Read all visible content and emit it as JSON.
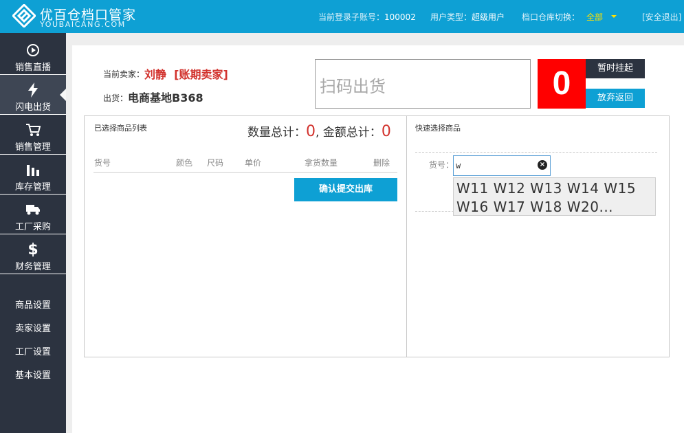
{
  "header": {
    "brand_cn": "优百仓档口管家",
    "brand_en": "YOUBAICANG.COM",
    "account_label": "当前登录子账号：",
    "account_value": "100002",
    "usertype_label": "用户类型：",
    "usertype_value": "超级用户",
    "warehouse_label": "档口仓库切换：",
    "warehouse_value": "全部",
    "logout": "[安全退出]"
  },
  "sidebar": {
    "items": [
      {
        "label": "销售直播",
        "icon": "play-circle-icon"
      },
      {
        "label": "闪电出货",
        "icon": "lightning-icon"
      },
      {
        "label": "销售管理",
        "icon": "cart-icon"
      },
      {
        "label": "库存管理",
        "icon": "bar-chart-icon"
      },
      {
        "label": "工厂采购",
        "icon": "truck-icon"
      },
      {
        "label": "财务管理",
        "icon": "dollar-icon"
      }
    ],
    "settings": [
      "商品设置",
      "卖家设置",
      "工厂设置",
      "基本设置"
    ]
  },
  "order": {
    "seller_label": "当前卖家：",
    "seller_value": "刘静  [账期卖家]",
    "out_label": "出货：",
    "out_value": "电商基地B368",
    "scan_placeholder": "扫码出货",
    "count": "0",
    "pause_label": "暂时挂起",
    "cancel_label": "放弃返回"
  },
  "list": {
    "title": "已选择商品列表",
    "qty_label": "数量总计：",
    "qty_value": "0",
    "amount_label": ", 金额总计：",
    "amount_value": "0",
    "columns": [
      "货号",
      "颜色",
      "尺码",
      "单价",
      "拿货数量",
      "删除"
    ],
    "confirm_label": "确认提交出库"
  },
  "quick": {
    "title": "快速选择商品",
    "sku_label": "货号：",
    "sku_value": "w",
    "suggestions": [
      "W11 W12 W13 W14 W15",
      "W16 W17 W18 W20..."
    ]
  }
}
